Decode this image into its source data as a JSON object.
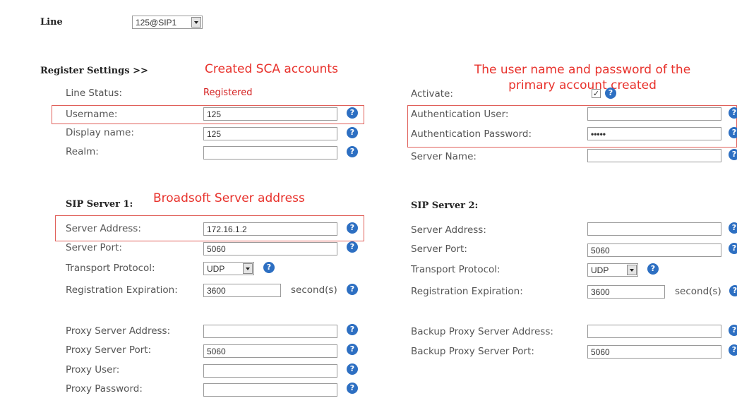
{
  "line": {
    "label": "Line",
    "value": "125@SIP1"
  },
  "register_settings": {
    "title": "Register Settings >>"
  },
  "annotations": {
    "sca": "Created SCA accounts",
    "primary": "The user name and password of the primary account created",
    "broadsoft": "Broadsoft Server address"
  },
  "left": {
    "line_status": {
      "label": "Line Status:",
      "value": "Registered"
    },
    "username": {
      "label": "Username:",
      "value": "125"
    },
    "display_name": {
      "label": "Display name:",
      "value": "125"
    },
    "realm": {
      "label": "Realm:",
      "value": ""
    },
    "sip_server_1": {
      "title": "SIP Server 1:",
      "server_address": {
        "label": "Server Address:",
        "value": "172.16.1.2"
      },
      "server_port": {
        "label": "Server Port:",
        "value": "5060"
      },
      "transport": {
        "label": "Transport Protocol:",
        "value": "UDP"
      },
      "expiration": {
        "label": "Registration Expiration:",
        "value": "3600",
        "unit": "second(s)"
      }
    },
    "proxy": {
      "address": {
        "label": "Proxy Server Address:",
        "value": ""
      },
      "port": {
        "label": "Proxy Server Port:",
        "value": "5060"
      },
      "user": {
        "label": "Proxy User:",
        "value": ""
      },
      "password": {
        "label": "Proxy Password:",
        "value": ""
      }
    }
  },
  "right": {
    "activate": {
      "label": "Activate:",
      "checked": true
    },
    "auth_user": {
      "label": "Authentication User:",
      "value": ""
    },
    "auth_password": {
      "label": "Authentication Password:",
      "value": "•••••"
    },
    "server_name": {
      "label": "Server Name:",
      "value": ""
    },
    "sip_server_2": {
      "title": "SIP Server 2:",
      "server_address": {
        "label": "Server Address:",
        "value": ""
      },
      "server_port": {
        "label": "Server Port:",
        "value": "5060"
      },
      "transport": {
        "label": "Transport Protocol:",
        "value": "UDP"
      },
      "expiration": {
        "label": "Registration Expiration:",
        "value": "3600",
        "unit": "second(s)"
      }
    },
    "backup_proxy": {
      "address": {
        "label": "Backup Proxy Server Address:",
        "value": ""
      },
      "port": {
        "label": "Backup Proxy Server Port:",
        "value": "5060"
      }
    }
  },
  "colors": {
    "annotation_red": "#e8322c",
    "help_blue": "#2d6fc2",
    "box_red": "#e0605a"
  },
  "icons": {
    "help": "help-icon",
    "dropdown": "chevron-down-icon"
  }
}
